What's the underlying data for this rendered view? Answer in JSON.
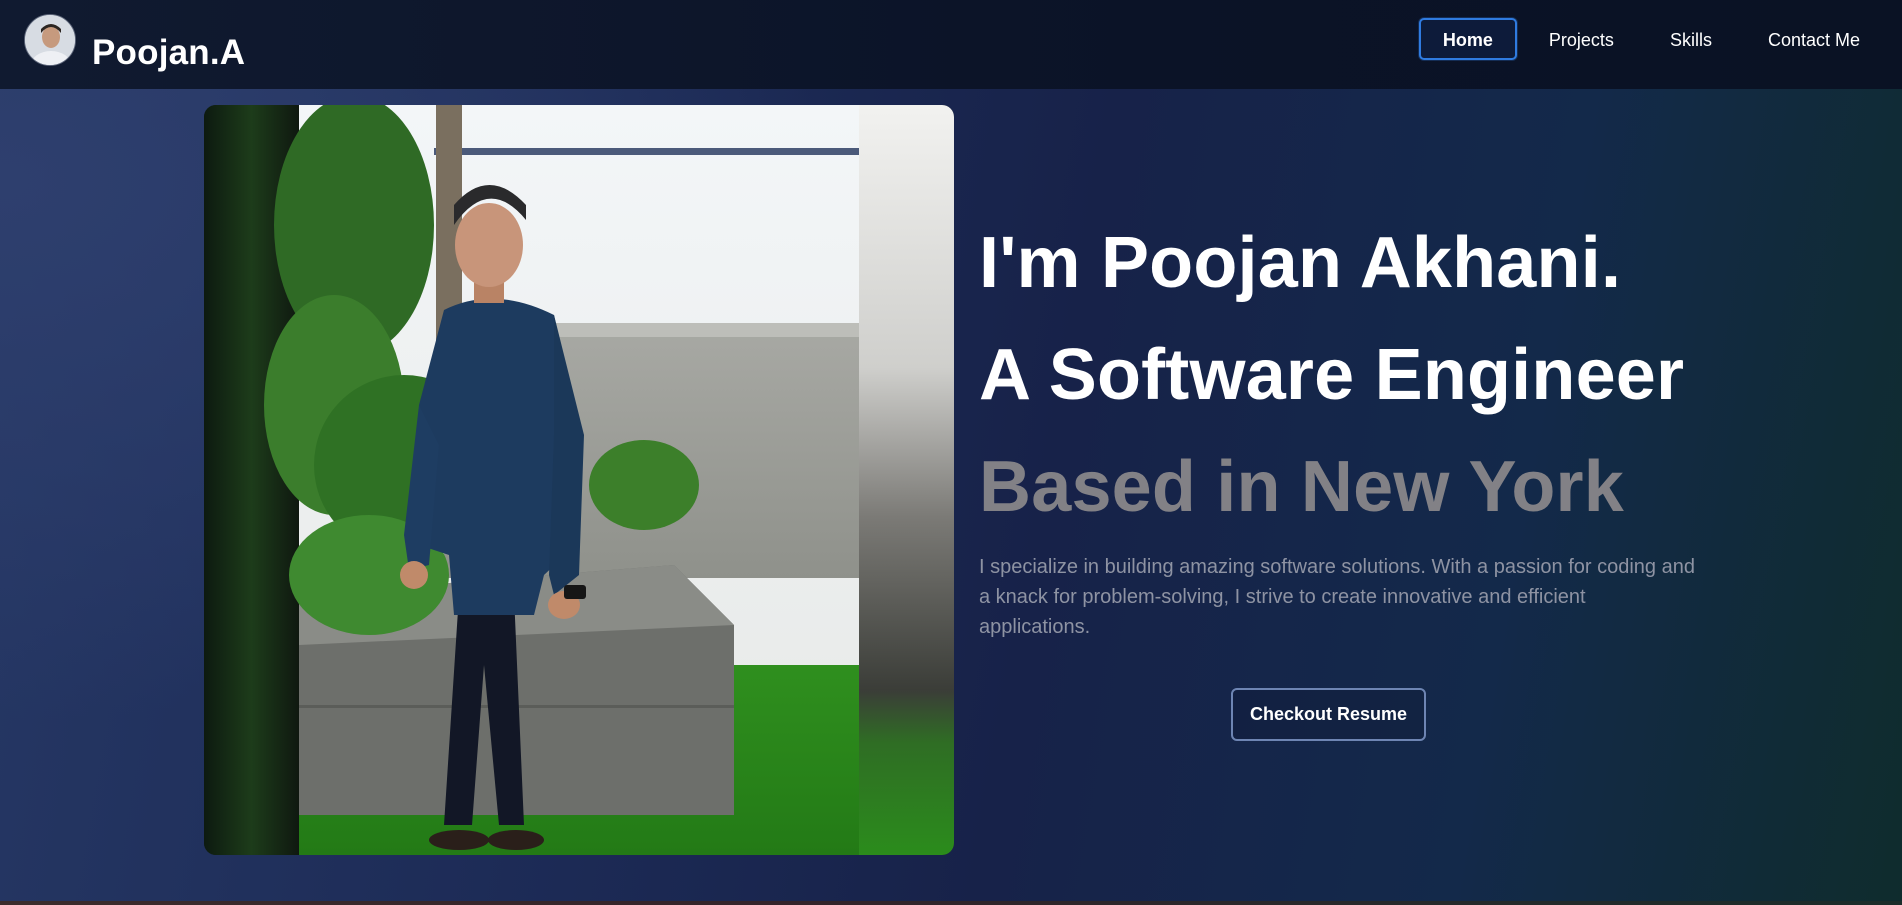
{
  "header": {
    "brand": "Poojan.A",
    "avatar_icon": "profile-avatar",
    "nav": [
      {
        "label": "Home",
        "active": true
      },
      {
        "label": "Projects",
        "active": false
      },
      {
        "label": "Skills",
        "active": false
      },
      {
        "label": "Contact Me",
        "active": false
      }
    ]
  },
  "hero": {
    "line1": "I'm Poojan Akhani.",
    "line2": "A Software Engineer",
    "line3": "Based in New York",
    "description": "I specialize in building amazing software solutions. With a passion for coding and a knack for problem-solving, I strive to create innovative and efficient applications.",
    "resume_button": "Checkout Resume"
  },
  "colors": {
    "accent": "#2f7be0",
    "muted_heading": "#828186",
    "button_border": "#6e85b3"
  }
}
